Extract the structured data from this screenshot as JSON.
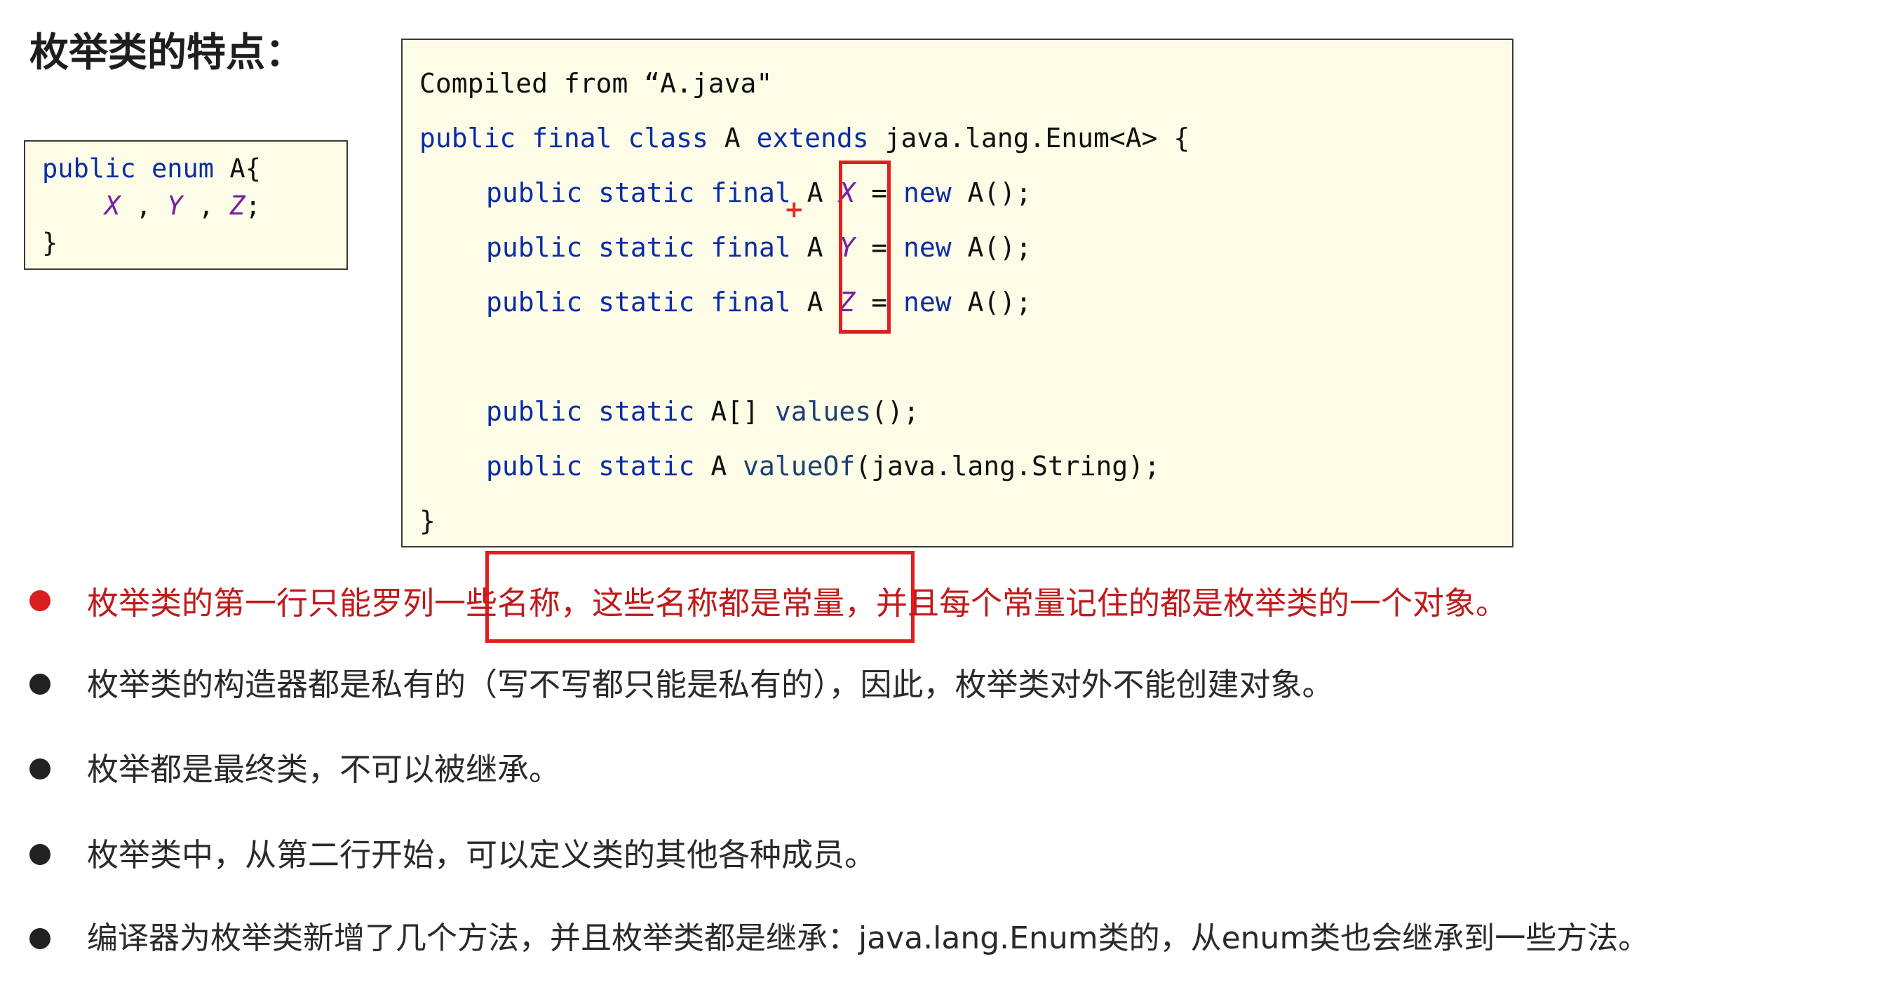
{
  "title": "枚举类的特点：",
  "enum_declaration": {
    "line1_kw1": "public",
    "line1_kw2": "enum",
    "line1_name": "A{",
    "constant_x": "X",
    "constant_y": "Y",
    "constant_z": "Z",
    "sep": ",",
    "end": ";",
    "close": "}"
  },
  "decompiled": {
    "compiled_from": "Compiled from “A.java\"",
    "kw_public": "public",
    "kw_final": "final",
    "kw_class": "class",
    "kw_extends": "extends",
    "kw_static": "static",
    "kw_new": "new",
    "class_name": "A",
    "super_type": "java.lang.Enum<A> {",
    "field_type": "A",
    "field_x": "X",
    "field_y": "Y",
    "field_z": "Z",
    "field_init": "= ",
    "ctor_call": "A();",
    "values_type": "A[]",
    "values_method": "values",
    "values_args": "();",
    "valueof_type": "A",
    "valueof_method": "valueOf",
    "valueof_args": "(java.lang.String);",
    "close": "}"
  },
  "annotation": {
    "marker": "+"
  },
  "bullets": [
    {
      "text": "枚举类的第一行只能罗列一些名称，这些名称都是常量，并且每个常量记住的都是枚举类的一个对象。",
      "highlight": true
    },
    {
      "text": "枚举类的构造器都是私有的（写不写都只能是私有的），因此，枚举类对外不能创建对象。",
      "highlight": false
    },
    {
      "text": "枚举都是最终类，不可以被继承。",
      "highlight": false
    },
    {
      "text": "枚举类中，从第二行开始，可以定义类的其他各种成员。",
      "highlight": false
    },
    {
      "text": "编译器为枚举类新增了几个方法，并且枚举类都是继承：java.lang.Enum类的，从enum类也会继承到一些方法。",
      "highlight": false
    }
  ],
  "colors": {
    "keyword": "#0c2ca6",
    "constant": "#7a1fa3",
    "highlight_red": "#c11a1a",
    "code_background": "#fdfde7"
  }
}
